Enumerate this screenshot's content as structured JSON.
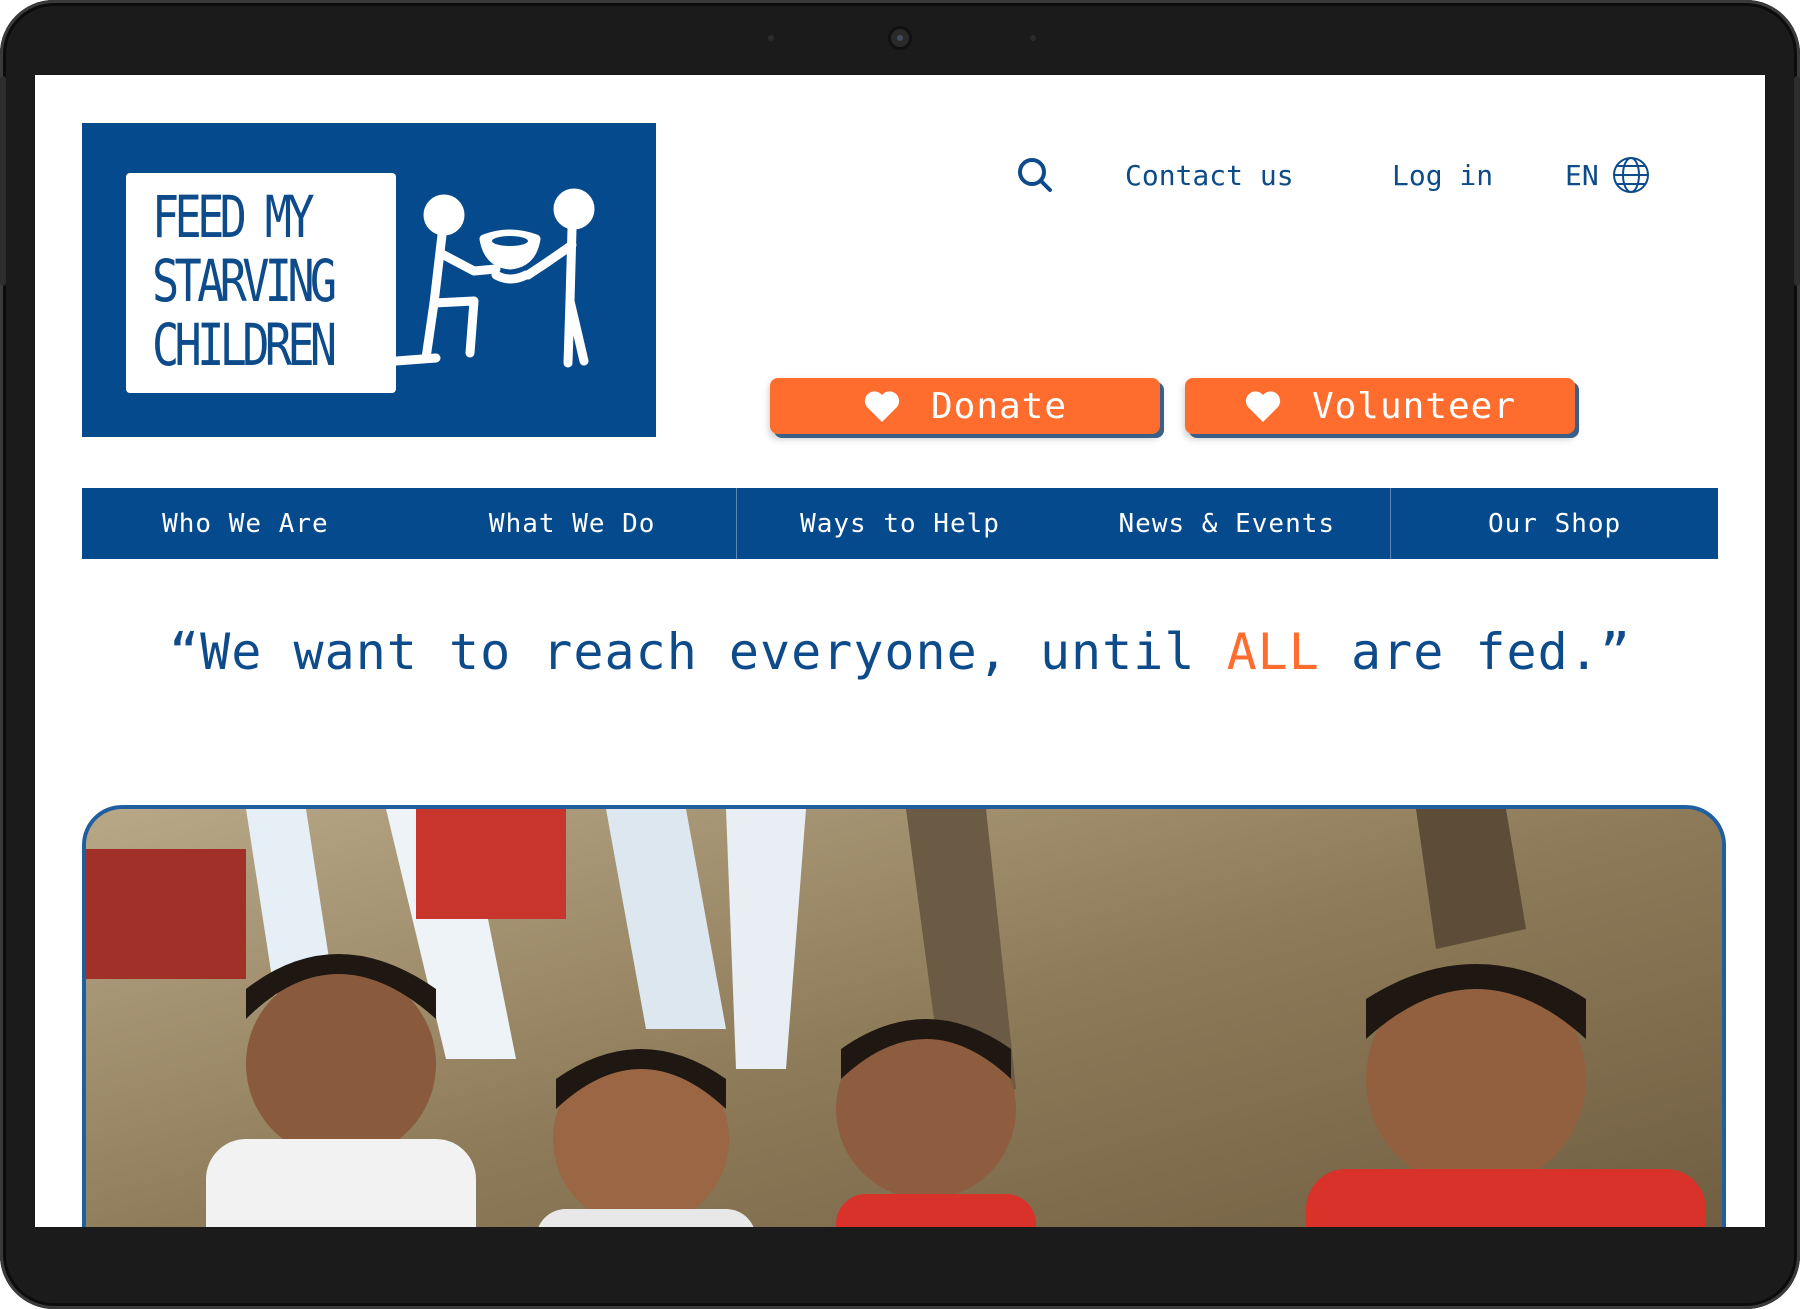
{
  "brand": {
    "logo_lines": [
      "FEED MY",
      "STARVING",
      "CHILDREN"
    ]
  },
  "utility_nav": {
    "search_icon": "search-icon",
    "contact": "Contact us",
    "login": "Log in",
    "language": "EN",
    "globe_icon": "globe-icon"
  },
  "cta": {
    "donate": "Donate",
    "volunteer": "Volunteer",
    "heart_icon": "heart-icon"
  },
  "main_nav": {
    "items": [
      {
        "label": "Who We Are"
      },
      {
        "label": "What We Do"
      },
      {
        "label": "Ways to Help"
      },
      {
        "label": "News & Events"
      },
      {
        "label": "Our Shop"
      }
    ]
  },
  "quote": {
    "open": "“We want to reach everyone, until ",
    "accent": "ALL",
    "close": " are fed.”"
  },
  "colors": {
    "brand_blue": "#064a8e",
    "accent_orange": "#ff6d2e"
  }
}
